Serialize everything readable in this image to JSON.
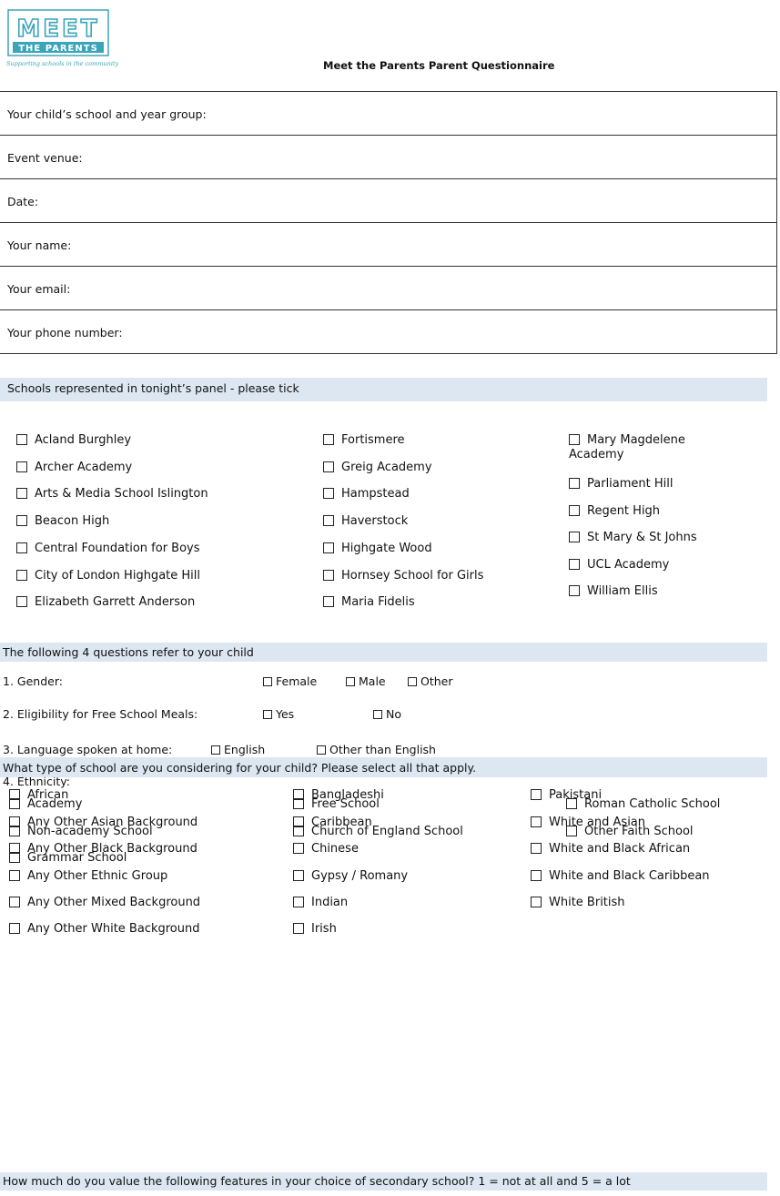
{
  "header": {
    "logo_line1": "MEET",
    "logo_line2": "THE PARENTS",
    "logo_tagline": "Supporting schools in the community",
    "title": "Meet the Parents Parent Questionnaire",
    "logo_color": "#3aa5b8"
  },
  "details": [
    "Your child’s school and year group:",
    "Event venue:",
    "Date:",
    "Your name:",
    "Your email:",
    "Your phone number:"
  ],
  "schools": {
    "heading": "Schools represented in tonight’s panel - please tick",
    "col1": [
      "Acland Burghley",
      "Archer Academy",
      "Arts & Media School Islington",
      "Beacon High",
      "Central Foundation for Boys",
      "City of London Highgate Hill",
      "Elizabeth Garrett Anderson"
    ],
    "col2": [
      "Fortismere",
      "Greig Academy",
      "Hampstead",
      "Haverstock",
      "Highgate Wood",
      "Hornsey School for Girls",
      "Maria Fidelis"
    ],
    "col3": [
      "Mary Magdelene Academy",
      "Parliament Hill",
      "Regent High",
      "St Mary & St Johns",
      "UCL Academy",
      "William Ellis"
    ]
  },
  "child": {
    "heading": "The following 4 questions refer to your child",
    "q1": "1. Gender:",
    "q1_opts": [
      "Female",
      "Male",
      "Other"
    ],
    "q2": "2. Eligibility for Free School Meals:",
    "q2_opts": [
      "Yes",
      "No"
    ],
    "q3": "3. Language spoken at home:",
    "q3_opts": [
      "English",
      "Other than English"
    ],
    "q4": "4. Ethnicity:",
    "eth_col1": [
      "African",
      "Any Other Asian Background",
      "Any Other Black Background",
      "Any Other Ethnic Group",
      "Any Other Mixed Background",
      "Any Other White Background"
    ],
    "eth_col2": [
      "Bangladeshi",
      "Caribbean",
      "Chinese",
      "Gypsy / Romany",
      "Indian",
      "Irish"
    ],
    "eth_col3": [
      "Pakistani",
      "White and Asian",
      "White and Black African",
      "White and Black Caribbean",
      "White British"
    ]
  },
  "school_type": {
    "heading": "What type of school are you considering for your child? Please select all that apply.",
    "col1": [
      "Academy",
      "Non-academy School",
      "Grammar School"
    ],
    "col2": [
      "Free School",
      "Church of England School"
    ],
    "col3": [
      "Roman Catholic School",
      "Other Faith School"
    ]
  },
  "value_question": "How much do you value the following features in your choice of secondary school? 1 = not at all and 5 = a lot",
  "colors": {
    "section_bar": "#dce7f1",
    "border": "#333333"
  }
}
